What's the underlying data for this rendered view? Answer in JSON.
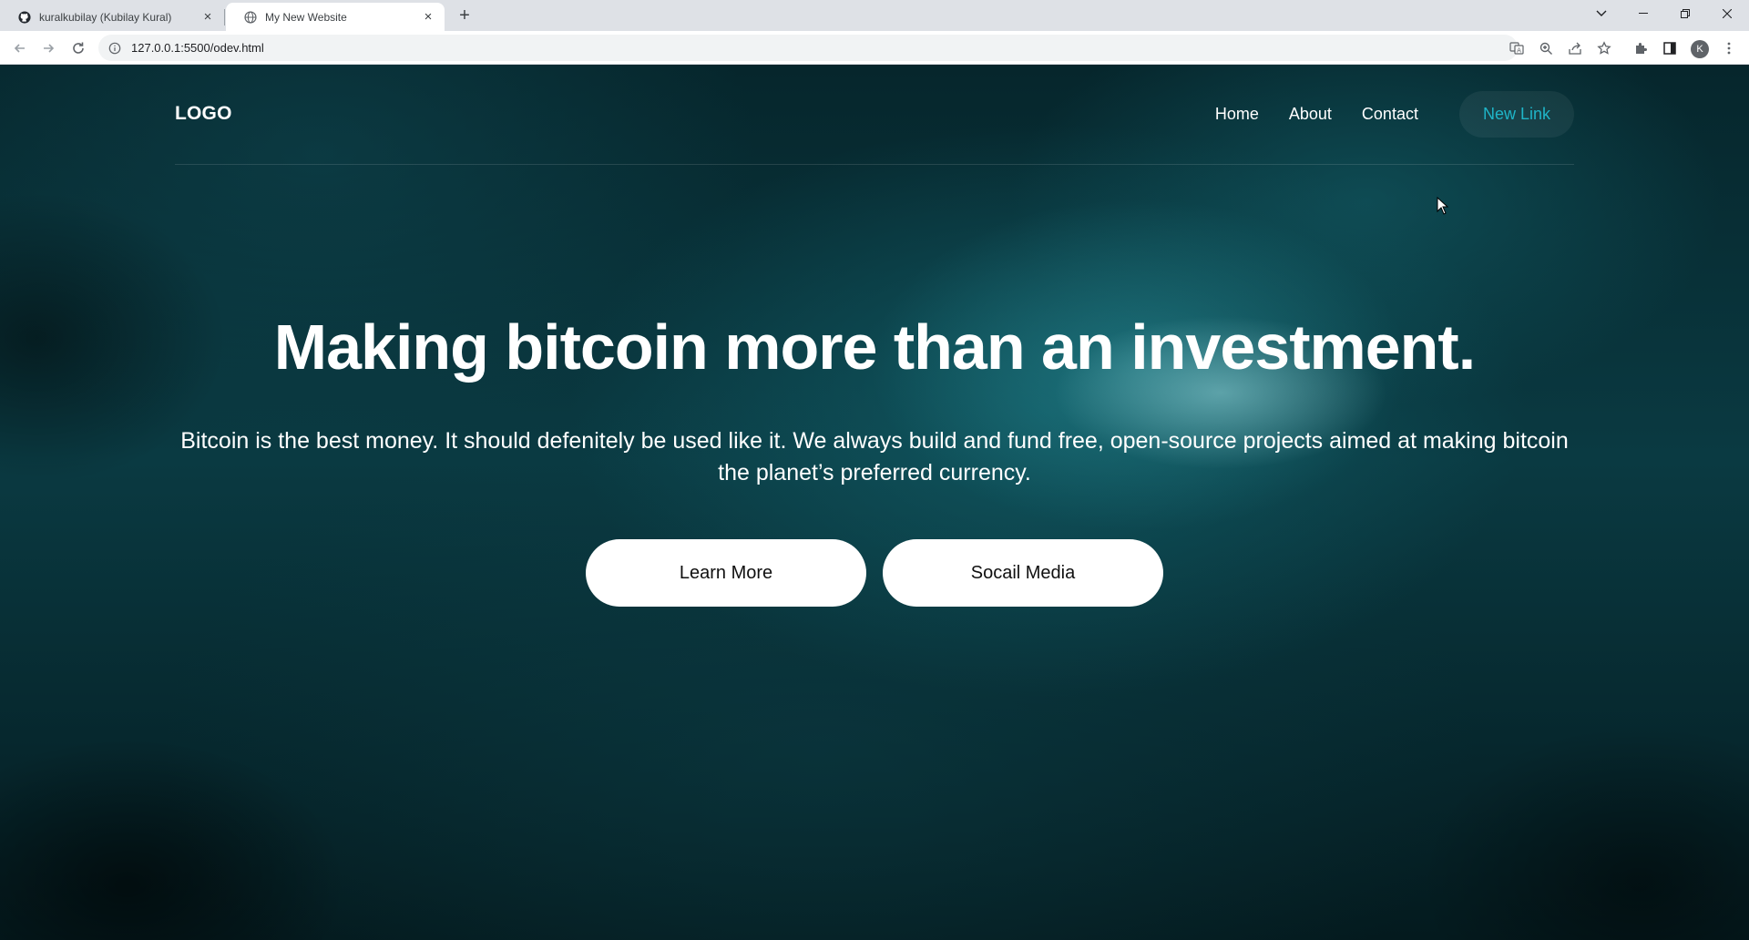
{
  "browser": {
    "tabs": [
      {
        "title": "kuralkubilay (Kubilay Kural)",
        "favicon": "github-icon",
        "active": false
      },
      {
        "title": "My New Website",
        "favicon": "globe-icon",
        "active": true
      }
    ],
    "new_tab_label": "+",
    "url": "127.0.0.1:5500/odev.html",
    "profile_initial": "K",
    "window_controls": [
      "tab-search-icon",
      "minimize-icon",
      "restore-icon",
      "close-icon"
    ],
    "toolbar_icons": [
      "translate-icon",
      "zoom-icon",
      "share-icon",
      "star-icon",
      "extensions-icon",
      "side-panel-icon",
      "menu-icon"
    ]
  },
  "site": {
    "logo": "LOGO",
    "nav": {
      "home": "Home",
      "about": "About",
      "contact": "Contact",
      "new_link": "New Link"
    },
    "hero": {
      "title": "Making bitcoin more than an investment.",
      "description": "Bitcoin is the best money. It should defenitely be used like it. We always build and fund free, open-source projects aimed at making bitcoin the planet’s preferred currency.",
      "primary_button": "Learn More",
      "secondary_button": "Socail Media"
    },
    "colors": {
      "accent": "#1fb5c8",
      "background": "#0a3a42",
      "text": "#ffffff",
      "button_bg": "#ffffff"
    }
  }
}
